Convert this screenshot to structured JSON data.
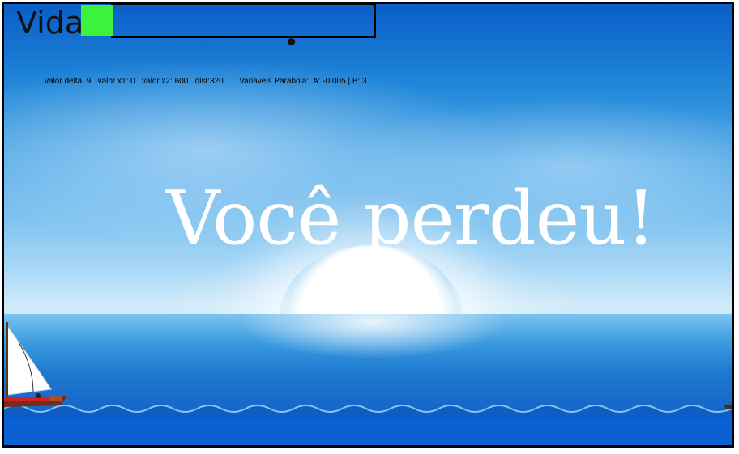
{
  "hud": {
    "life_label": "Vida",
    "life_fraction": 0.12,
    "debug_text": "valor delta: 9   valor x1: 0   valor x2: 600   dist:320       Variaveis Parabola:  A: -0.005 | B: 3"
  },
  "message": {
    "game_over": "Você perdeu!"
  },
  "colors": {
    "life_fill": "#3df23d",
    "sea_deep": "#0a60d4",
    "message_text": "#ffffff"
  },
  "icons": {
    "player": "sailboat-icon",
    "enemy": "boat-icon"
  }
}
